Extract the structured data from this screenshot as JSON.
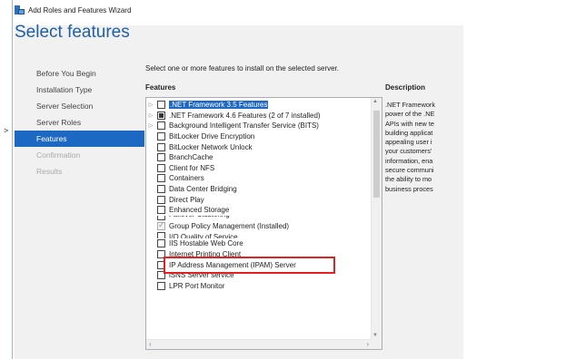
{
  "window": {
    "title": "Add Roles and Features Wizard",
    "icon": "server-manager-icon"
  },
  "page": {
    "title": "Select features",
    "instruction": "Select one or more features to install on the selected server."
  },
  "nav": {
    "items": [
      {
        "label": "Before You Begin",
        "state": "normal"
      },
      {
        "label": "Installation Type",
        "state": "normal"
      },
      {
        "label": "Server Selection",
        "state": "normal"
      },
      {
        "label": "Server Roles",
        "state": "normal"
      },
      {
        "label": "Features",
        "state": "selected"
      },
      {
        "label": "Confirmation",
        "state": "disabled"
      },
      {
        "label": "Results",
        "state": "disabled"
      }
    ]
  },
  "features": {
    "header": "Features",
    "items": [
      {
        "label": ".NET Framework 3.5 Features",
        "expandable": true,
        "state": "unchecked",
        "highlighted": true
      },
      {
        "label": ".NET Framework 4.6 Features (2 of 7 installed)",
        "expandable": true,
        "state": "partial"
      },
      {
        "label": "Background Intelligent Transfer Service (BITS)",
        "expandable": true,
        "state": "unchecked"
      },
      {
        "label": "BitLocker Drive Encryption",
        "expandable": false,
        "state": "unchecked"
      },
      {
        "label": "BitLocker Network Unlock",
        "expandable": false,
        "state": "unchecked"
      },
      {
        "label": "BranchCache",
        "expandable": false,
        "state": "unchecked"
      },
      {
        "label": "Client for NFS",
        "expandable": false,
        "state": "unchecked"
      },
      {
        "label": "Containers",
        "expandable": false,
        "state": "unchecked"
      },
      {
        "label": "Data Center Bridging",
        "expandable": false,
        "state": "unchecked"
      },
      {
        "label": "Direct Play",
        "expandable": false,
        "state": "unchecked"
      },
      {
        "label": "Enhanced Storage",
        "expandable": false,
        "state": "unchecked"
      },
      {
        "label": "Failover Clustering",
        "expandable": false,
        "state": "unchecked",
        "clipped": "bottom"
      },
      {
        "label": "Group Policy Management (Installed)",
        "expandable": false,
        "state": "checked"
      },
      {
        "label": "I/O Quality of Service",
        "expandable": false,
        "state": "unchecked",
        "clipped": "top"
      },
      {
        "label": "IIS Hostable Web Core",
        "expandable": false,
        "state": "unchecked"
      },
      {
        "label": "Internet Printing Client",
        "expandable": false,
        "state": "unchecked"
      },
      {
        "label": "IP Address Management (IPAM) Server",
        "expandable": false,
        "state": "unchecked"
      },
      {
        "label": "iSNS Server service",
        "expandable": false,
        "state": "unchecked"
      },
      {
        "label": "LPR Port Monitor",
        "expandable": false,
        "state": "unchecked"
      }
    ]
  },
  "description": {
    "header": "Description",
    "lines": [
      ".NET Framework",
      "power of the .NE",
      "APIs with new te",
      "building applicat",
      "appealing user i",
      "your customers'",
      "information, ena",
      "secure communi",
      "the ability to mo",
      "business proces"
    ]
  },
  "colors": {
    "accent": "#1d68c2",
    "title": "#1f5fa6",
    "annotation": "#e32020"
  }
}
